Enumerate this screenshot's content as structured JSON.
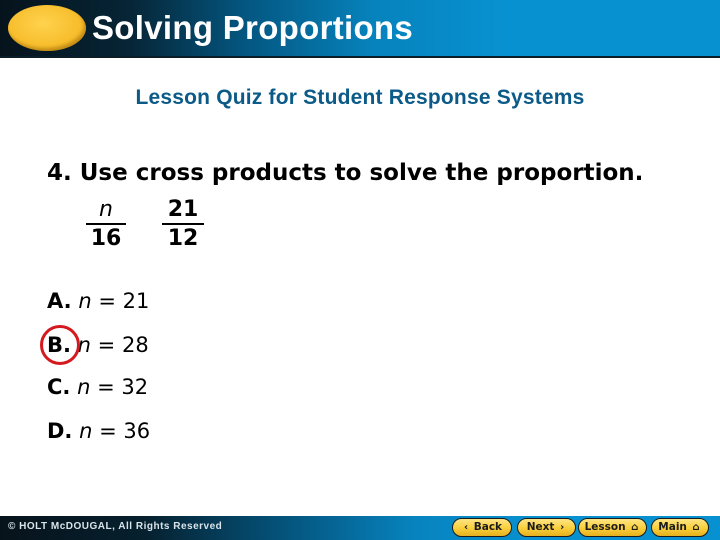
{
  "header": {
    "title": "Solving Proportions",
    "oval_color": "#f7bd2c"
  },
  "subtitle": "Lesson Quiz for Student Response Systems",
  "question": {
    "text": "4. Use cross products to solve the proportion.",
    "proportion": {
      "left": {
        "numerator": "n",
        "denominator": "16"
      },
      "right": {
        "numerator": "21",
        "denominator": "12"
      }
    }
  },
  "choices": [
    {
      "letter": "A.",
      "variable": "n",
      "equals": "=",
      "value": "21",
      "selected": false
    },
    {
      "letter": "B.",
      "variable": "n",
      "equals": "=",
      "value": "28",
      "selected": true
    },
    {
      "letter": "C.",
      "variable": "n",
      "equals": "=",
      "value": "32",
      "selected": false
    },
    {
      "letter": "D.",
      "variable": "n",
      "equals": "=",
      "value": "36",
      "selected": false
    }
  ],
  "answer_highlight_color": "#d41a1f",
  "footer": {
    "copyright": "© HOLT McDOUGAL, All Rights Reserved",
    "buttons": {
      "back": {
        "label": "Back",
        "icon": "chevron-left-icon",
        "glyph": "‹"
      },
      "next": {
        "label": "Next",
        "icon": "chevron-right-icon",
        "glyph": "›"
      },
      "lesson": {
        "label": "Lesson",
        "icon": "home-icon",
        "glyph": "⌂"
      },
      "main": {
        "label": "Main",
        "icon": "home-icon",
        "glyph": "⌂"
      }
    }
  }
}
